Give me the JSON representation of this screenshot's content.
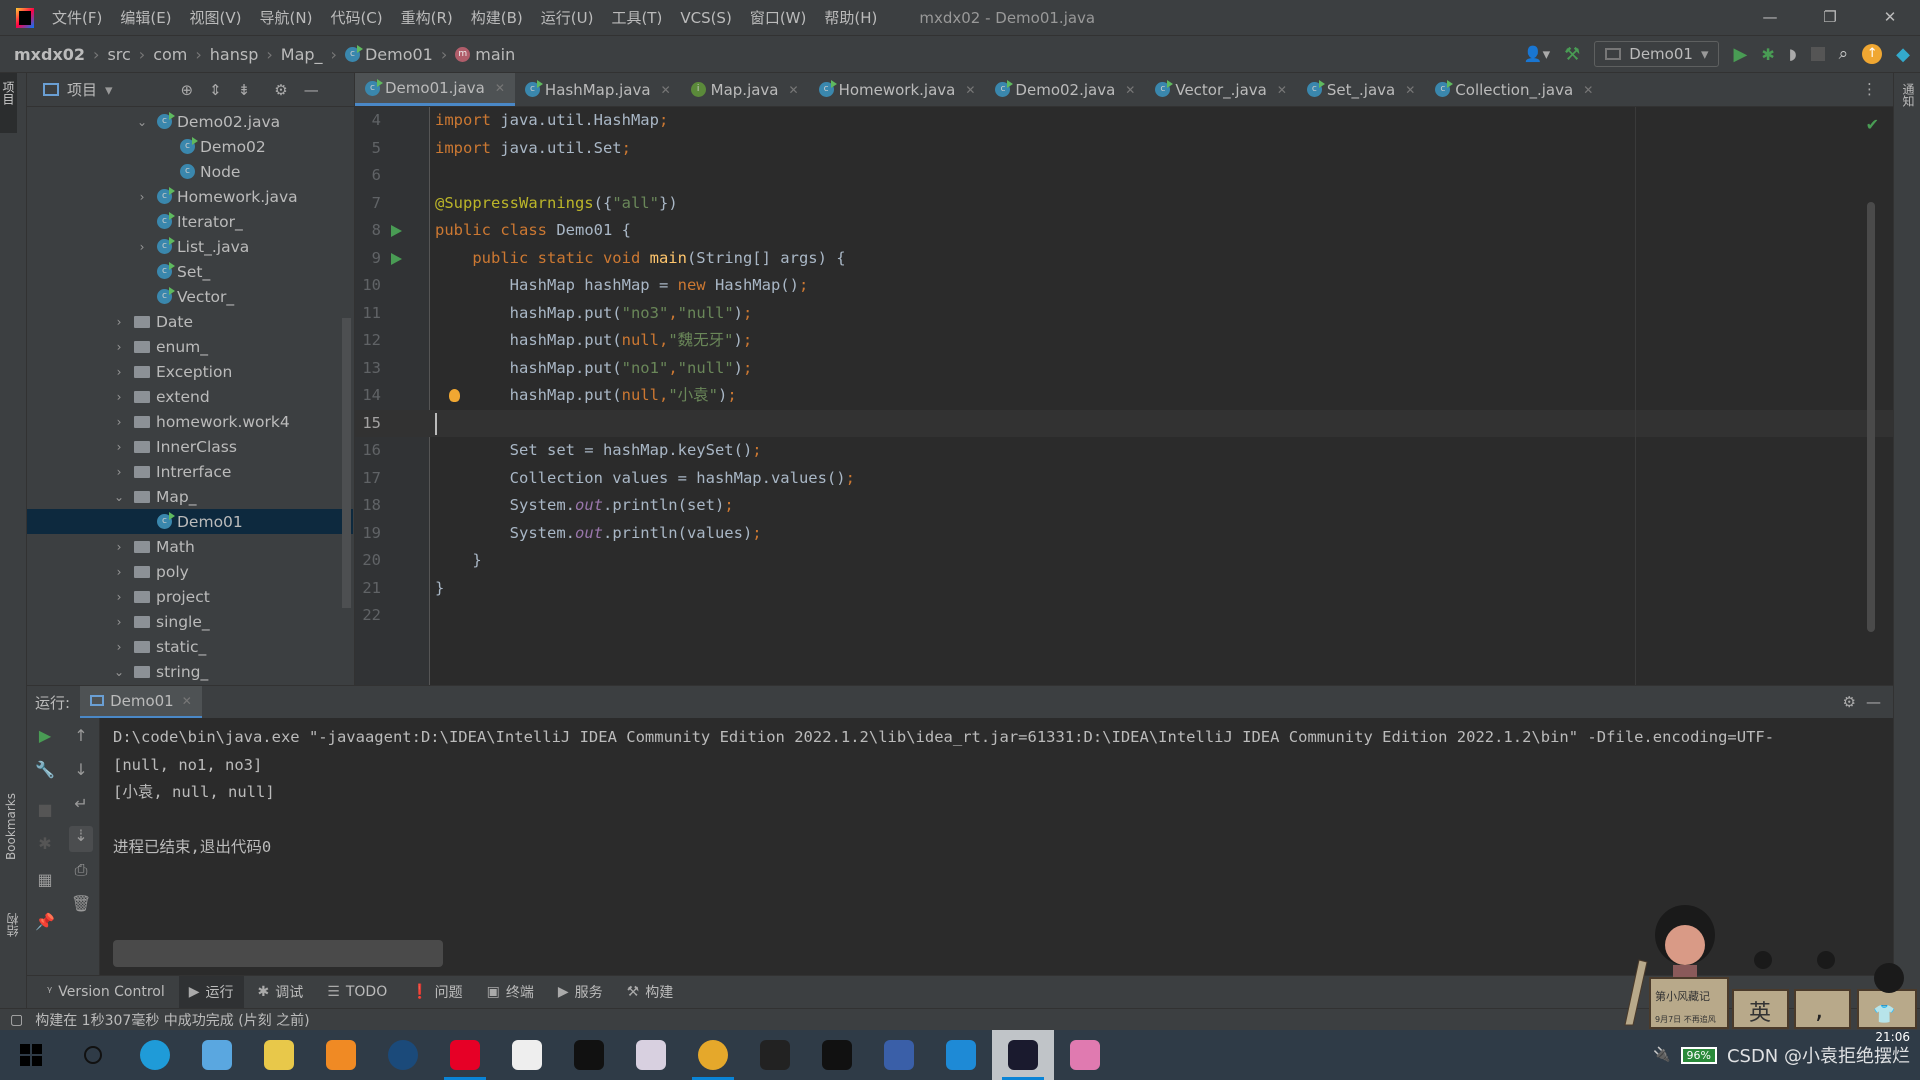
{
  "window": {
    "title": "mxdx02 - Demo01.java",
    "controls": [
      "—",
      "❐",
      "✕"
    ]
  },
  "menu": [
    "文件(F)",
    "编辑(E)",
    "视图(V)",
    "导航(N)",
    "代码(C)",
    "重构(R)",
    "构建(B)",
    "运行(U)",
    "工具(T)",
    "VCS(S)",
    "窗口(W)",
    "帮助(H)"
  ],
  "breadcrumb": [
    "mxdx02",
    "src",
    "com",
    "hansp",
    "Map_",
    "Demo01",
    "main"
  ],
  "toolbar": {
    "run_config": "Demo01",
    "icons": [
      "user-icon",
      "build-hammer-icon",
      "run-icon",
      "debug-icon",
      "coverage-icon",
      "stop-icon",
      "search-icon",
      "update-icon",
      "plugin-icon"
    ]
  },
  "project": {
    "title": "项目",
    "tree": [
      {
        "label": "Demo02.java",
        "kind": "file",
        "indent": 2,
        "chev": "v"
      },
      {
        "label": "Demo02",
        "kind": "class",
        "indent": 3,
        "chev": ""
      },
      {
        "label": "Node",
        "kind": "class-plain",
        "indent": 3,
        "chev": ""
      },
      {
        "label": "Homework.java",
        "kind": "file",
        "indent": 2,
        "chev": ">"
      },
      {
        "label": "Iterator_",
        "kind": "class",
        "indent": 2,
        "chev": ""
      },
      {
        "label": "List_.java",
        "kind": "file",
        "indent": 2,
        "chev": ">"
      },
      {
        "label": "Set_",
        "kind": "class",
        "indent": 2,
        "chev": ""
      },
      {
        "label": "Vector_",
        "kind": "class",
        "indent": 2,
        "chev": ""
      },
      {
        "label": "Date",
        "kind": "folder",
        "indent": 1,
        "chev": ">"
      },
      {
        "label": "enum_",
        "kind": "folder",
        "indent": 1,
        "chev": ">"
      },
      {
        "label": "Exception",
        "kind": "folder",
        "indent": 1,
        "chev": ">"
      },
      {
        "label": "extend",
        "kind": "folder",
        "indent": 1,
        "chev": ">"
      },
      {
        "label": "homework.work4",
        "kind": "folder",
        "indent": 1,
        "chev": ">"
      },
      {
        "label": "InnerClass",
        "kind": "folder",
        "indent": 1,
        "chev": ">"
      },
      {
        "label": "Intrerface",
        "kind": "folder",
        "indent": 1,
        "chev": ">"
      },
      {
        "label": "Map_",
        "kind": "folder",
        "indent": 1,
        "chev": "v"
      },
      {
        "label": "Demo01",
        "kind": "class",
        "indent": 2,
        "chev": "",
        "selected": true
      },
      {
        "label": "Math",
        "kind": "folder",
        "indent": 1,
        "chev": ">"
      },
      {
        "label": "poly",
        "kind": "folder",
        "indent": 1,
        "chev": ">"
      },
      {
        "label": "project",
        "kind": "folder",
        "indent": 1,
        "chev": ">"
      },
      {
        "label": "single_",
        "kind": "folder",
        "indent": 1,
        "chev": ">"
      },
      {
        "label": "static_",
        "kind": "folder",
        "indent": 1,
        "chev": ">"
      },
      {
        "label": "string_",
        "kind": "folder",
        "indent": 1,
        "chev": "v"
      }
    ]
  },
  "tabs": [
    {
      "label": "Demo01.java",
      "icon": "C",
      "active": true
    },
    {
      "label": "HashMap.java",
      "icon": "C"
    },
    {
      "label": "Map.java",
      "icon": "I"
    },
    {
      "label": "Homework.java",
      "icon": "C"
    },
    {
      "label": "Demo02.java",
      "icon": "C"
    },
    {
      "label": "Vector_.java",
      "icon": "C"
    },
    {
      "label": "Set_.java",
      "icon": "C"
    },
    {
      "label": "Collection_.java",
      "icon": "C"
    }
  ],
  "editor": {
    "current_line": 15,
    "lines": [
      {
        "n": "4",
        "t": [
          [
            "import ",
            "k"
          ],
          [
            "java.util.HashMap",
            "p"
          ],
          [
            ";",
            "k"
          ]
        ]
      },
      {
        "n": "5",
        "t": [
          [
            "import ",
            "k"
          ],
          [
            "java.util.Set",
            "p"
          ],
          [
            ";",
            "k"
          ]
        ]
      },
      {
        "n": "6",
        "t": []
      },
      {
        "n": "7",
        "t": [
          [
            "@SuppressWarnings",
            "a"
          ],
          [
            "({",
            "p"
          ],
          [
            "\"all\"",
            "s"
          ],
          [
            "})",
            "p"
          ]
        ]
      },
      {
        "n": "8",
        "run": true,
        "t": [
          [
            "public class ",
            "k"
          ],
          [
            "Demo01 {",
            "p"
          ]
        ]
      },
      {
        "n": "9",
        "run": true,
        "t": [
          [
            "    public static void ",
            "k"
          ],
          [
            "main",
            "m"
          ],
          [
            "(String[] args) {",
            "p"
          ]
        ]
      },
      {
        "n": "10",
        "t": [
          [
            "        HashMap hashMap = ",
            "p"
          ],
          [
            "new ",
            "k"
          ],
          [
            "HashMap()",
            "p"
          ],
          [
            ";",
            "k"
          ]
        ]
      },
      {
        "n": "11",
        "t": [
          [
            "        hashMap.put(",
            "p"
          ],
          [
            "\"no3\"",
            "s"
          ],
          [
            ",",
            "k"
          ],
          [
            "\"null\"",
            "s"
          ],
          [
            ")",
            "p"
          ],
          [
            ";",
            "k"
          ]
        ]
      },
      {
        "n": "12",
        "t": [
          [
            "        hashMap.put(",
            "p"
          ],
          [
            "null,",
            "k"
          ],
          [
            "\"魏无牙\"",
            "s"
          ],
          [
            ")",
            "p"
          ],
          [
            ";",
            "k"
          ]
        ]
      },
      {
        "n": "13",
        "t": [
          [
            "        hashMap.put(",
            "p"
          ],
          [
            "\"no1\"",
            "s"
          ],
          [
            ",",
            "k"
          ],
          [
            "\"null\"",
            "s"
          ],
          [
            ")",
            "p"
          ],
          [
            ";",
            "k"
          ]
        ]
      },
      {
        "n": "14",
        "bulb": true,
        "t": [
          [
            "        hashMap.put(",
            "p"
          ],
          [
            "null,",
            "k"
          ],
          [
            "\"小袁\"",
            "s"
          ],
          [
            ")",
            "p"
          ],
          [
            ";",
            "k"
          ]
        ]
      },
      {
        "n": "15",
        "t": []
      },
      {
        "n": "16",
        "t": [
          [
            "        Set set = hashMap.keySet()",
            "p"
          ],
          [
            ";",
            "k"
          ]
        ]
      },
      {
        "n": "17",
        "t": [
          [
            "        Collection values = hashMap.values()",
            "p"
          ],
          [
            ";",
            "k"
          ]
        ]
      },
      {
        "n": "18",
        "t": [
          [
            "        System.",
            "p"
          ],
          [
            "out",
            "f"
          ],
          [
            ".println(set)",
            "p"
          ],
          [
            ";",
            "k"
          ]
        ]
      },
      {
        "n": "19",
        "t": [
          [
            "        System.",
            "p"
          ],
          [
            "out",
            "f"
          ],
          [
            ".println(values)",
            "p"
          ],
          [
            ";",
            "k"
          ]
        ]
      },
      {
        "n": "20",
        "t": [
          [
            "    }",
            "p"
          ]
        ]
      },
      {
        "n": "21",
        "t": [
          [
            "}",
            "p"
          ]
        ]
      },
      {
        "n": "22",
        "t": []
      }
    ]
  },
  "run": {
    "label": "运行:",
    "tab": "Demo01",
    "output": [
      "D:\\code\\bin\\java.exe \"-javaagent:D:\\IDEA\\IntelliJ IDEA Community Edition 2022.1.2\\lib\\idea_rt.jar=61331:D:\\IDEA\\IntelliJ IDEA Community Edition 2022.1.2\\bin\" -Dfile.encoding=UTF-",
      "[null, no1, no3]",
      "[小袁, null, null]",
      "",
      "进程已结束,退出代码0"
    ]
  },
  "side": {
    "left_bottom": "Bookmarks",
    "left_bottom2": "结构",
    "left_top": "项目",
    "right_top": "通知"
  },
  "bottom_tools": [
    {
      "label": "Version Control",
      "icon": "ᵞ"
    },
    {
      "label": "运行",
      "icon": "▶",
      "active": true
    },
    {
      "label": "调试",
      "icon": "✱"
    },
    {
      "label": "TODO",
      "icon": "☰"
    },
    {
      "label": "问题",
      "icon": "❗"
    },
    {
      "label": "终端",
      "icon": "▣"
    },
    {
      "label": "服务",
      "icon": "▶"
    },
    {
      "label": "构建",
      "icon": "⚒"
    }
  ],
  "status": "构建在 1秒307毫秒 中成功完成 (片刻 之前)",
  "taskbar": {
    "apps": [
      {
        "name": "windows-start",
        "color": "#000000"
      },
      {
        "name": "search",
        "color": "#2f3b47"
      },
      {
        "name": "edge",
        "color": "#1f9bd8"
      },
      {
        "name": "computer",
        "color": "#5aa7e0"
      },
      {
        "name": "raccoon-app",
        "color": "#e8c84a"
      },
      {
        "name": "everything-search",
        "color": "#f08a24"
      },
      {
        "name": "steam",
        "color": "#1b4a7a"
      },
      {
        "name": "netease-music",
        "color": "#e60026",
        "active": true
      },
      {
        "name": "bolt-app",
        "color": "#eeeeee"
      },
      {
        "name": "epic-games",
        "color": "#111111"
      },
      {
        "name": "anime-app",
        "color": "#d8d0e0"
      },
      {
        "name": "chrome",
        "color": "#e5a82b",
        "active": true
      },
      {
        "name": "g-app",
        "color": "#222222"
      },
      {
        "name": "qq",
        "color": "#111111"
      },
      {
        "name": "dev-cpp",
        "color": "#3a5fa8"
      },
      {
        "name": "vscode",
        "color": "#1e8ad6"
      },
      {
        "name": "intellij",
        "color": "#1a1a2e",
        "selected": true
      },
      {
        "name": "colorful-app",
        "color": "#e07ab0"
      }
    ],
    "battery": "96%",
    "time": "21:06",
    "watermark": "CSDN @小袁拒绝摆烂"
  },
  "mascot": {
    "sign": "第小风藏记",
    "date": "9月7日 不再追风",
    "boxes": [
      "英",
      ",",
      "👕"
    ]
  },
  "colors": {
    "keyword": "#cc7832",
    "string": "#6a8759",
    "annotation": "#bbb529",
    "method": "#ffc66d",
    "static_field": "#9876aa",
    "text": "#a9b7c6",
    "selection": "#0d293e",
    "accent": "#4a88c7"
  }
}
